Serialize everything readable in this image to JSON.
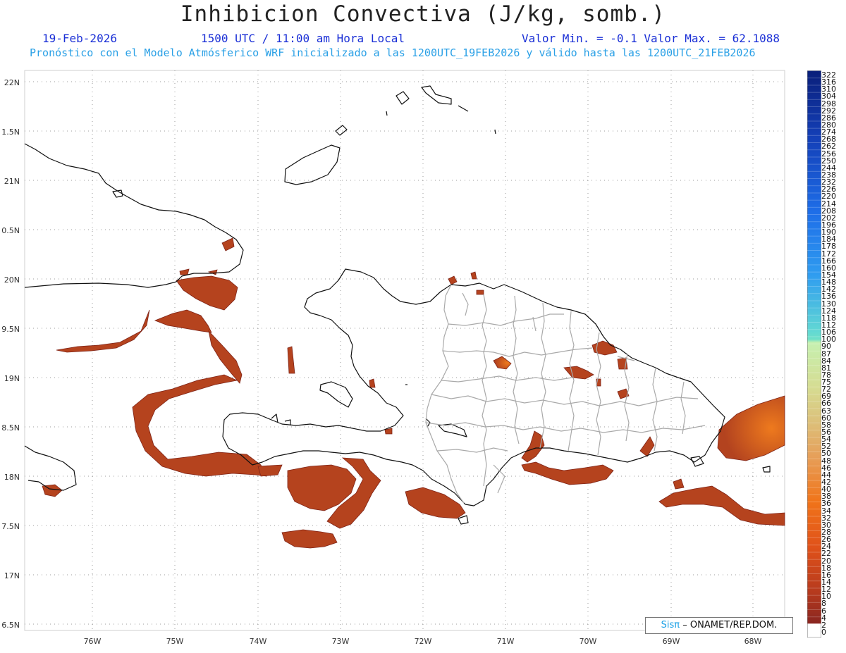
{
  "header": {
    "title": "Inhibicion Convectiva (J/kg, somb.)",
    "date": "19-Feb-2026",
    "time": "1500 UTC / 11:00 am Hora Local",
    "min_max": "Valor Min. = -0.1  Valor Max. = 62.1088",
    "forecast": "Pronóstico con el Modelo Atmósferico WRF inicializado a las 1200UTC_19FEB2026 y válido hasta las  1200UTC_21FEB2026"
  },
  "axes": {
    "lat_labels": [
      "22N",
      "1.5N",
      "21N",
      "0.5N",
      "20N",
      "9.5N",
      "19N",
      "8.5N",
      "18N",
      "7.5N",
      "17N",
      "6.5N"
    ],
    "lon_labels": [
      "76W",
      "75W",
      "74W",
      "73W",
      "72W",
      "71W",
      "70W",
      "69W",
      "68W"
    ]
  },
  "legend": {
    "labels": [
      "322",
      "316",
      "310",
      "304",
      "298",
      "292",
      "286",
      "280",
      "274",
      "268",
      "262",
      "256",
      "250",
      "244",
      "238",
      "232",
      "226",
      "220",
      "214",
      "208",
      "202",
      "196",
      "190",
      "184",
      "178",
      "172",
      "166",
      "160",
      "154",
      "148",
      "142",
      "136",
      "130",
      "124",
      "118",
      "112",
      "106",
      "100",
      "90",
      "87",
      "84",
      "81",
      "78",
      "75",
      "72",
      "69",
      "66",
      "63",
      "60",
      "58",
      "56",
      "54",
      "52",
      "50",
      "48",
      "46",
      "44",
      "42",
      "40",
      "38",
      "36",
      "34",
      "32",
      "30",
      "28",
      "26",
      "24",
      "22",
      "20",
      "18",
      "16",
      "14",
      "12",
      "10",
      "8",
      "6",
      "4",
      "2",
      "0"
    ],
    "colors_top": [
      "#0a1f7a",
      "#1448c8",
      "#1e78ee",
      "#3cb0ee",
      "#5cd6d0",
      "#b8eaa8",
      "#d8d08a",
      "#e6a65a",
      "#f06f14",
      "#e05014",
      "#b63a1e",
      "#8a2620"
    ]
  },
  "credit": {
    "sis": "Sisπ",
    "org": "– ONAMET/REP.DOM."
  },
  "colors": {
    "shade": "#b5431e",
    "shade_edge": "#8a2a1a",
    "shade_hot": "#e5671a",
    "coast": "#111111",
    "border": "#a8a8a8",
    "grid": "#a0a0a0"
  }
}
